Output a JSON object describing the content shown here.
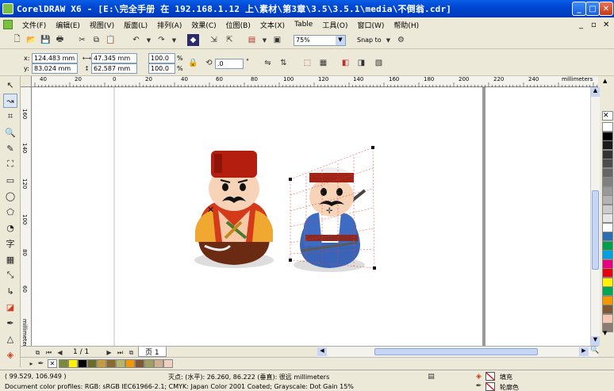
{
  "window": {
    "title": "CorelDRAW X6 - [E:\\完全手册 在 192.168.1.12 上\\素材\\第3章\\3.5\\3.5.1\\media\\不倒翁.cdr]"
  },
  "menu": [
    "文件(F)",
    "编辑(E)",
    "视图(V)",
    "版面(L)",
    "排列(A)",
    "效果(C)",
    "位图(B)",
    "文本(X)",
    "Table",
    "工具(O)",
    "窗口(W)",
    "帮助(H)"
  ],
  "toolbar": {
    "zoom": "75%",
    "snap_to": "Snap to"
  },
  "property_bar": {
    "x_label": "x:",
    "x": "124.483 mm",
    "y_label": "y:",
    "y": "83.024 mm",
    "w": "47.345 mm",
    "h": "62.587 mm",
    "scale_w": "100.0",
    "scale_h": "100.0",
    "pct": "%",
    "angle": ".0",
    "deg": "°"
  },
  "ruler": {
    "h_ticks": [
      "40",
      "20",
      "0",
      "20",
      "40",
      "60",
      "80",
      "100",
      "120",
      "140",
      "160",
      "180",
      "200",
      "220",
      "240"
    ],
    "unit": "millimeters",
    "v_ticks": [
      "160",
      "140",
      "120",
      "100",
      "80",
      "60"
    ],
    "v_unit": "millimeters"
  },
  "pages": {
    "counter": "1 / 1",
    "tab": "页 1"
  },
  "status": {
    "coords": "( 99.529, 106.949 )",
    "snap_info": "灭点: (水平): 26.260, 86.222 (垂直): 很远  millimeters",
    "fill_label": "填充",
    "outline_label": "轮廓色",
    "profiles": "Document color profiles: RGB: sRGB IEC61966-2.1; CMYK: Japan Color 2001 Coated; Grayscale: Dot Gain 15%"
  },
  "colors": {
    "palette": [
      "#ffffff",
      "#000000",
      "#1a1a1a",
      "#333333",
      "#4d4d4d",
      "#666666",
      "#808080",
      "#999999",
      "#b3b3b3",
      "#cccccc",
      "#e6e6e6",
      "#ffffff",
      "#2a6db3",
      "#00a04a",
      "#00a0e0",
      "#e4007f",
      "#e60012",
      "#fff100",
      "#00a651",
      "#f39800",
      "#7f5936",
      "#f7c7b4",
      "#8c7b70"
    ],
    "doc_palette": [
      "#7a8a3a",
      "#fff100",
      "#000000",
      "#6b6b2a",
      "#c79a3e",
      "#8a6a2a",
      "#b5b56b",
      "#f39800",
      "#7f5936",
      "#a0a060",
      "#d0b090",
      "#f0d0c0"
    ]
  }
}
